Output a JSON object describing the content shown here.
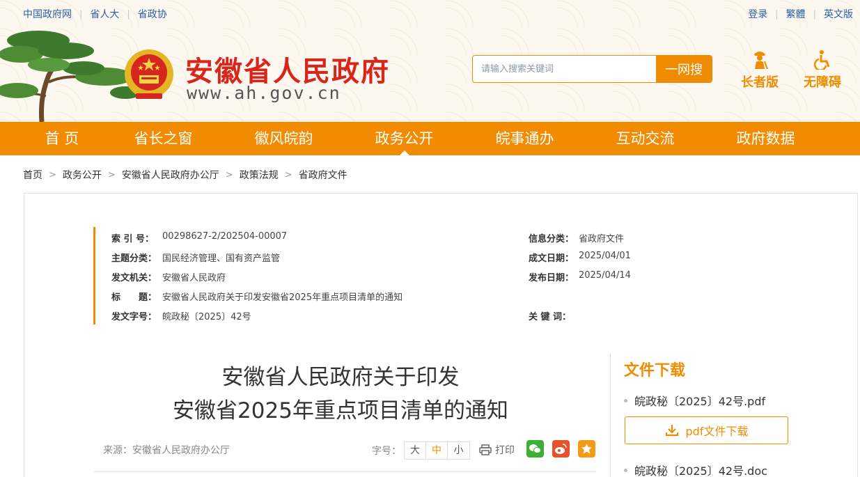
{
  "topbar": {
    "left_links": [
      "中国政府网",
      "省人大",
      "省政协"
    ],
    "right_links": [
      "登录",
      "繁體",
      "英文版"
    ]
  },
  "site": {
    "title": "安徽省人民政府",
    "url": "www.ah.gov.cn"
  },
  "search": {
    "placeholder": "请输入搜索关键词",
    "button": "一网搜"
  },
  "modes": {
    "elder": "长者版",
    "accessible": "无障碍"
  },
  "nav": {
    "items": [
      "首 页",
      "省长之窗",
      "徽风皖韵",
      "政务公开",
      "皖事通办",
      "互动交流",
      "政府数据"
    ],
    "active": "政务公开"
  },
  "breadcrumb": [
    "首页",
    "政务公开",
    "安徽省人民政府办公厅",
    "政策法规",
    "省政府文件"
  ],
  "meta": {
    "index_label": "索 引 号：",
    "index_value": "00298627-2/202504-00007",
    "topic_label": "主题分类：",
    "topic_value": "国民经济管理、国有资产监管",
    "issuer_label": "发文机关：",
    "issuer_value": "安徽省人民政府",
    "title_label": "标　　题：",
    "title_value": "安徽省人民政府关于印发安徽省2025年重点项目清单的通知",
    "docno_label": "发文字号：",
    "docno_value": "皖政秘〔2025〕42号",
    "category_label": "信息分类：",
    "category_value": "省政府文件",
    "written_label": "成文日期：",
    "written_value": "2025/04/01",
    "published_label": "发布日期：",
    "published_value": "2025/04/14",
    "keywords_label": "关 键 词：",
    "keywords_value": ""
  },
  "document": {
    "title_line1": "安徽省人民政府关于印发",
    "title_line2": "安徽省2025年重点项目清单的通知",
    "source": "来源：安徽省人民政府办公厅",
    "fontsize_label": "字号：",
    "fontsize_options": [
      "大",
      "中",
      "小"
    ],
    "fontsize_selected": "中",
    "print_label": "打印"
  },
  "download": {
    "title": "文件下载",
    "pdf_name": "皖政秘〔2025〕42号.pdf",
    "pdf_button": "pdf文件下载",
    "doc_name": "皖政秘〔2025〕42号.doc"
  },
  "colors": {
    "brand_orange": "#f38b00",
    "title_red": "#d9261c",
    "link_blue": "#2b5fa6"
  }
}
